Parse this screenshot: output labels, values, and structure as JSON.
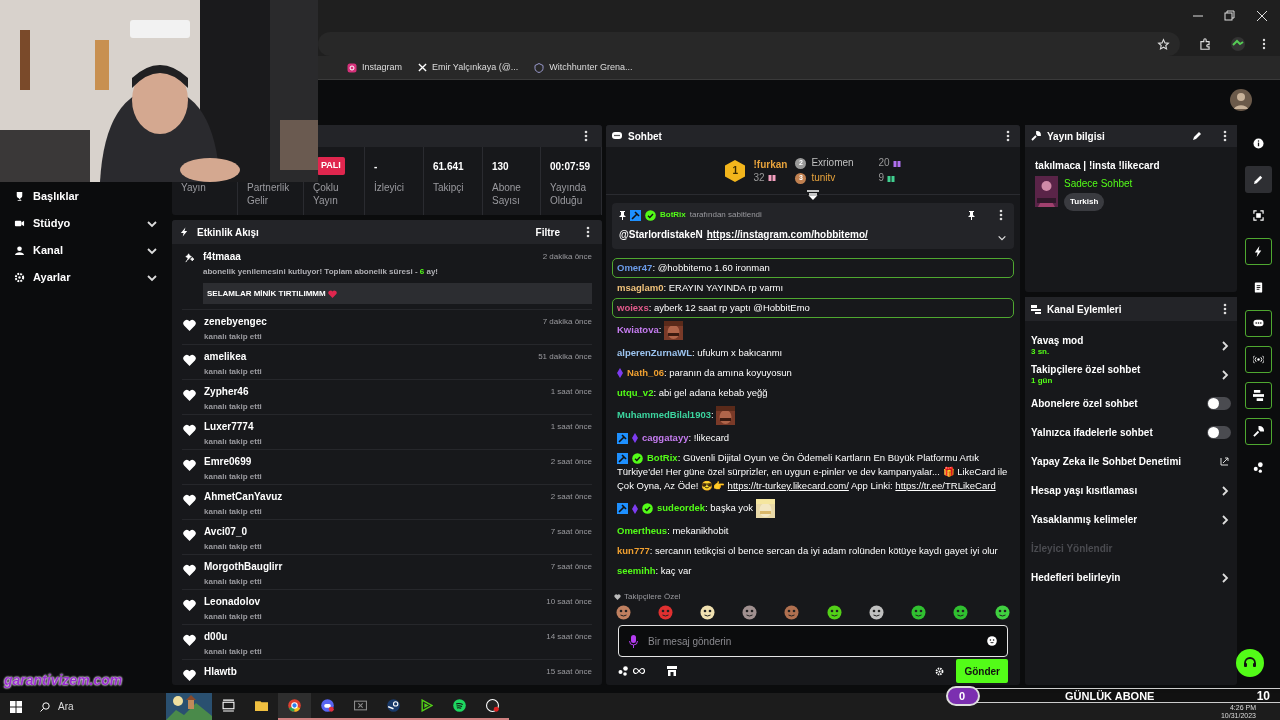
{
  "browser": {
    "bookmarks": [
      {
        "kind": "instagram",
        "label": "Instagram"
      },
      {
        "kind": "x",
        "label": "Emir Yalçınkaya (@..."
      },
      {
        "kind": "shield",
        "label": "Witchhunter Grena..."
      }
    ]
  },
  "nav": [
    {
      "label": "Başlıklar",
      "chevron": false
    },
    {
      "label": "Stüdyo",
      "chevron": true
    },
    {
      "label": "Kanal",
      "chevron": true
    },
    {
      "label": "Ayarlar",
      "chevron": true
    }
  ],
  "stats": [
    {
      "label": "Yayın"
    },
    {
      "label": "Partnerlik Gelir"
    },
    {
      "label": "Çoklu Yayın",
      "badge": "PALI"
    },
    {
      "value": "-",
      "label": "İzleyici"
    },
    {
      "value": "61.641",
      "label": "Takipçi"
    },
    {
      "value": "130",
      "label": "Abone Sayısı"
    },
    {
      "value": "00:07:59",
      "label": "Yayında Olduğu"
    }
  ],
  "activity": {
    "title": "Etkinlik Akışı",
    "filter": "Filtre",
    "items": [
      {
        "kind": "resub",
        "user": "f4tmaaa",
        "time": "2 dakika önce",
        "text": "abonelik yenilemesini kutluyor! Toplam abonelik süresi - ",
        "months": "6",
        "suffix": " ay!",
        "message": "SELAMLAR MİNİK TIRTILIMMM"
      },
      {
        "kind": "follow",
        "user": "zenebyengec",
        "time": "7 dakika önce",
        "text": "kanalı takip etti"
      },
      {
        "kind": "follow",
        "user": "amelikea",
        "time": "51 dakika önce",
        "text": "kanalı takip etti"
      },
      {
        "kind": "follow",
        "user": "Zypher46",
        "time": "1 saat önce",
        "text": "kanalı takip etti"
      },
      {
        "kind": "follow",
        "user": "Luxer7774",
        "time": "1 saat önce",
        "text": "kanalı takip etti"
      },
      {
        "kind": "follow",
        "user": "Emre0699",
        "time": "2 saat önce",
        "text": "kanalı takip etti"
      },
      {
        "kind": "follow",
        "user": "AhmetCanYavuz",
        "time": "2 saat önce",
        "text": "kanalı takip etti"
      },
      {
        "kind": "follow",
        "user": "Avci07_0",
        "time": "7 saat önce",
        "text": "kanalı takip etti"
      },
      {
        "kind": "follow",
        "user": "MorgothBauglirr",
        "time": "7 saat önce",
        "text": "kanalı takip etti"
      },
      {
        "kind": "follow",
        "user": "Leonadolov",
        "time": "10 saat önce",
        "text": "kanalı takip etti"
      },
      {
        "kind": "follow",
        "user": "d00u",
        "time": "14 saat önce",
        "text": "kanalı takip etti"
      },
      {
        "kind": "follow",
        "user": "Hlawtb",
        "time": "15 saat önce"
      }
    ]
  },
  "chat": {
    "title": "Sohbet",
    "leaders": [
      {
        "rank": "1",
        "name": "!furkan",
        "count": "32",
        "color": "#e8a33c"
      },
      {
        "rank": "2",
        "name": "Exriomen",
        "count": "20",
        "color": "#c0c0c0"
      },
      {
        "rank": "3",
        "name": "tunitv",
        "count": "9",
        "color": "#e8a33c"
      }
    ],
    "pinned": {
      "by": "BotRix",
      "note": "tarafından sabitlendi",
      "mention": "@StarlordistakeN",
      "link": "https://instagram.com/hobbitemo/"
    },
    "separator": ": ",
    "messages": [
      {
        "user": "Omer47",
        "color": "#6b9be8",
        "highlighted": true,
        "parts": [
          {
            "text": "@hobbitemo 1.60 ironman"
          }
        ]
      },
      {
        "user": "msaglam0",
        "color": "#f0c27a",
        "highlighted": false,
        "parts": [
          {
            "text": "ERAYIN YAYINDA rp varmı"
          }
        ]
      },
      {
        "user": "woiexs",
        "color": "#e05a8a",
        "highlighted": true,
        "parts": [
          {
            "text": "ayberk 12 saat rp yaptı @HobbitEmo"
          }
        ]
      },
      {
        "user": "Kwiatova",
        "color": "#c57cf0",
        "highlighted": false,
        "emote": true
      },
      {
        "user": "alperenZurnaWL",
        "color": "#9cc4f0",
        "highlighted": false,
        "parts": [
          {
            "text": "ufukum x bakıcanmı"
          }
        ]
      },
      {
        "user": "Nath_06",
        "color": "#f0a030",
        "highlighted": false,
        "badges": [
          {
            "kind": "sub"
          }
        ],
        "parts": [
          {
            "text": "paranın da amına koyuyosun"
          }
        ]
      },
      {
        "user": "utqu_v2",
        "color": "#53fc18",
        "highlighted": false,
        "parts": [
          {
            "text": "abi gel adana kebab yeğğ"
          }
        ]
      },
      {
        "user": "MuhammedBilal1903",
        "color": "#3cd6a0",
        "highlighted": false,
        "emote": true
      },
      {
        "user": "caggatayy",
        "color": "#c57cf0",
        "highlighted": false,
        "badges": [
          {
            "kind": "mod"
          },
          {
            "kind": "sub"
          }
        ],
        "parts": [
          {
            "text": "!likecard"
          }
        ]
      },
      {
        "user": "BotRix",
        "color": "#53fc18",
        "highlighted": false,
        "badges": [
          {
            "kind": "mod"
          },
          {
            "kind": "verified"
          }
        ],
        "parts": [
          {
            "text": "Güvenli Dijital Oyun ve Ön Ödemeli Kartların En Büyük Platformu Artık Türkiye'de! Her güne özel sürprizler, en uygun e-pinler ve dev kampanyalar... 🎁 LikeCard ile Çok Oyna, Az Öde! 😎👉 "
          },
          {
            "link": "https://tr-turkey.likecard.com/"
          },
          {
            "text": " App Linki: "
          },
          {
            "link": "https://tr.ee/TRLikeCard"
          }
        ]
      },
      {
        "user": "sudeordek",
        "color": "#53fc18",
        "highlighted": false,
        "badges": [
          {
            "kind": "mod"
          },
          {
            "kind": "sub"
          },
          {
            "kind": "verified"
          }
        ],
        "emote": true,
        "parts": [
          {
            "text": "başka yok"
          }
        ]
      },
      {
        "user": "Omertheus",
        "color": "#53fc18",
        "highlighted": false,
        "parts": [
          {
            "text": "mekanikhobit"
          }
        ]
      },
      {
        "user": "kun777",
        "color": "#f0a030",
        "highlighted": false,
        "parts": [
          {
            "text": "sercanın tetikçisi ol bence sercan da iyi adam rolünden kötüye kaydı gayet iyi olur"
          }
        ]
      },
      {
        "user": "seemihh",
        "color": "#53fc18",
        "highlighted": false,
        "parts": [
          {
            "text": "kaç var"
          }
        ]
      }
    ],
    "emote_label": "Takipçilere Özel",
    "input": {
      "placeholder": "Bir mesaj gönderin"
    },
    "send": "Gönder"
  },
  "info": {
    "title": "Yayın bilgisi",
    "stream_title": "takılmaca | !insta !likecard",
    "category": "Sadece Sohbet",
    "tag": "Turkish"
  },
  "actions": {
    "title": "Kanal Eylemleri",
    "items": [
      {
        "kind": "link",
        "label": "Yavaş mod",
        "value": "3 sn."
      },
      {
        "kind": "link",
        "label": "Takipçilere özel sohbet",
        "value": "1 gün"
      },
      {
        "kind": "toggle",
        "label": "Abonelere özel sohbet",
        "on": false
      },
      {
        "kind": "toggle",
        "label": "Yalnızca ifadelerle sohbet",
        "on": false
      },
      {
        "kind": "external",
        "label": "Yapay Zeka ile Sohbet Denetimi"
      },
      {
        "kind": "link",
        "label": "Hesap yaşı kısıtlaması"
      },
      {
        "kind": "link",
        "label": "Yasaklanmış kelimeler"
      },
      {
        "kind": "disabled",
        "label": "İzleyici Yönlendir"
      },
      {
        "kind": "link",
        "label": "Hedefleri belirleyin"
      }
    ]
  },
  "rail": [
    {
      "kind": "info",
      "selected": false,
      "pinned": false
    },
    {
      "kind": "pencil",
      "selected": true,
      "pinned": false
    },
    {
      "kind": "scan",
      "selected": false,
      "pinned": false
    },
    {
      "kind": "bolt",
      "selected": false,
      "pinned": true
    },
    {
      "kind": "doc",
      "selected": false,
      "pinned": false
    },
    {
      "kind": "chat",
      "selected": false,
      "pinned": true
    },
    {
      "kind": "broadcast",
      "selected": false,
      "pinned": true
    },
    {
      "kind": "layout",
      "selected": false,
      "pinned": true
    },
    {
      "kind": "wrench",
      "selected": false,
      "pinned": true
    },
    {
      "kind": "dots",
      "selected": false,
      "pinned": false
    }
  ],
  "overlay": {
    "logo": "garantivizem.com",
    "goal": {
      "current": "0",
      "label": "GÜNLÜK ABONE",
      "target": "10"
    }
  },
  "taskbar": {
    "search": "Ara",
    "apps": [
      {
        "kind": "taskview",
        "active": false
      },
      {
        "kind": "folder",
        "active": false
      },
      {
        "kind": "chrome",
        "active": true
      },
      {
        "kind": "discord",
        "active": true
      },
      {
        "kind": "xbox",
        "active": true
      },
      {
        "kind": "steam",
        "active": true
      },
      {
        "kind": "play",
        "active": true
      },
      {
        "kind": "spotify",
        "active": true
      },
      {
        "kind": "obs",
        "active": true
      }
    ],
    "time": "4:26 PM",
    "date": "10/31/2023"
  }
}
